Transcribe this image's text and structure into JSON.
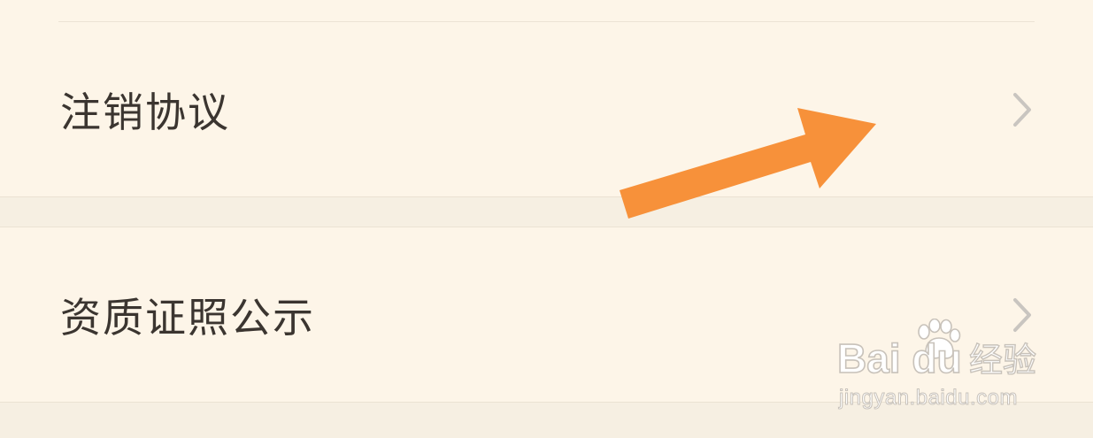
{
  "settings_list": {
    "items": [
      {
        "label": "注销协议"
      },
      {
        "label": "资质证照公示"
      }
    ]
  },
  "annotation": {
    "arrow_color": "#f7913a"
  },
  "watermark": {
    "logo_text": "Bai du",
    "logo_suffix": "经验",
    "url": "jingyan.baidu.com"
  },
  "colors": {
    "background": "#fdf5e8",
    "separator": "#f6efe2",
    "label_text": "#3b3530",
    "chevron": "#c9c5c0"
  },
  "icons": {
    "row_chevron": "chevron-right-icon",
    "annotation_arrow": "arrow-icon",
    "watermark_paw": "paw-icon"
  }
}
